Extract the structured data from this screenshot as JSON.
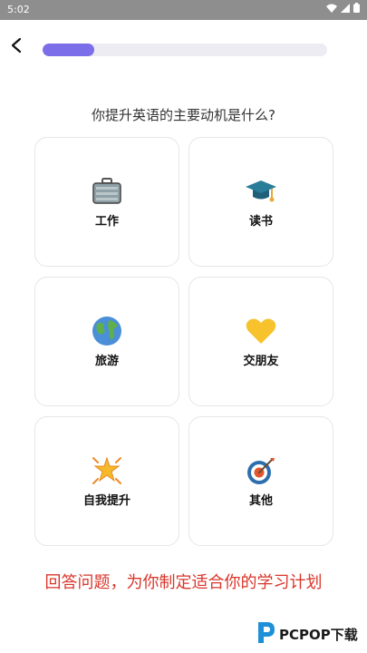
{
  "status_bar": {
    "time": "5:02"
  },
  "progress": {
    "fraction": 0.18,
    "color": "#7c6ee8"
  },
  "question": "你提升英语的主要动机是什么?",
  "options": [
    {
      "label": "工作",
      "icon": "briefcase-icon"
    },
    {
      "label": "读书",
      "icon": "graduation-cap-icon"
    },
    {
      "label": "旅游",
      "icon": "globe-icon"
    },
    {
      "label": "交朋友",
      "icon": "heart-icon"
    },
    {
      "label": "自我提升",
      "icon": "sparkle-icon"
    },
    {
      "label": "其他",
      "icon": "target-icon"
    }
  ],
  "footer_tip": "回答问题，为你制定适合你的学习计划",
  "watermark": {
    "text": "PCPOP下载"
  }
}
